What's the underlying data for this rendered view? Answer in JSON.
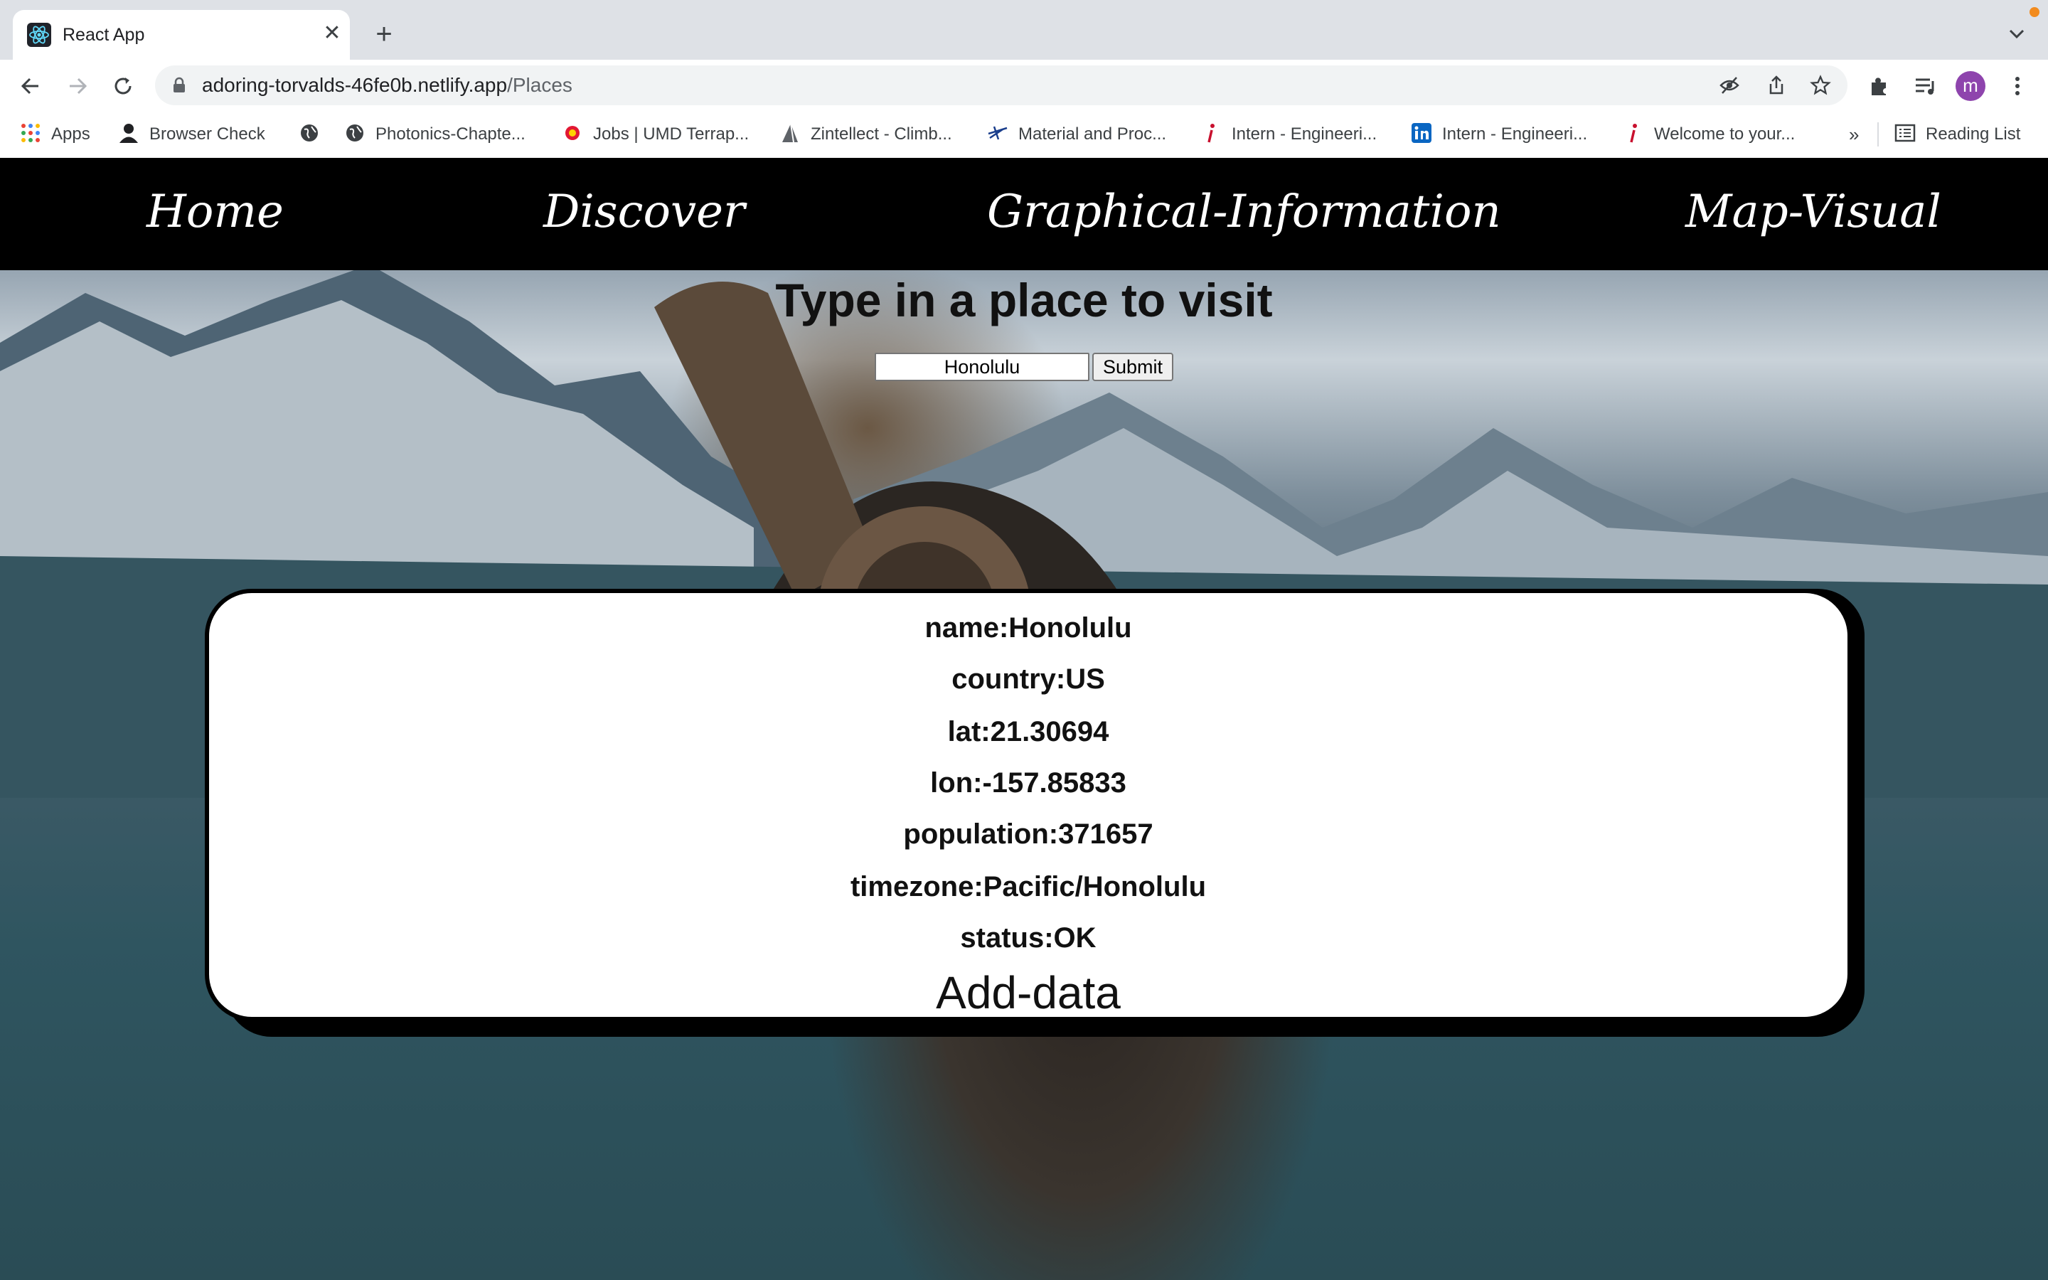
{
  "browser": {
    "tab": {
      "title": "React App",
      "favicon": "react-icon"
    },
    "address": {
      "domain": "adoring-torvalds-46fe0b.netlify.app",
      "path": "/Places"
    },
    "profile_initial": "m",
    "bookmarks": [
      {
        "label": "Apps",
        "icon": "apps-grid-icon"
      },
      {
        "label": "Browser Check",
        "icon": "person-icon"
      },
      {
        "label": "",
        "icon": "globe-icon"
      },
      {
        "label": "Photonics-Chapte...",
        "icon": "globe-icon"
      },
      {
        "label": "Jobs | UMD Terrap...",
        "icon": "umd-icon"
      },
      {
        "label": "Zintellect - Climb...",
        "icon": "zintellect-icon"
      },
      {
        "label": "Material and Proc...",
        "icon": "plane-icon"
      },
      {
        "label": "Intern - Engineeri...",
        "icon": "info-icon"
      },
      {
        "label": "Intern - Engineeri...",
        "icon": "linkedin-icon"
      },
      {
        "label": "Welcome to your...",
        "icon": "info-icon"
      }
    ],
    "more": "»",
    "reading_list": "Reading List"
  },
  "nav": {
    "home": "Home",
    "discover": "Discover",
    "graphical": "Graphical-Information",
    "map": "Map-Visual"
  },
  "search": {
    "heading": "Type in a place to visit",
    "value": "Honolulu",
    "submit": "Submit"
  },
  "place": {
    "name": "name:Honolulu",
    "country": "country:US",
    "lat": "lat:21.30694",
    "lon": "lon:-157.85833",
    "population": "population:371657",
    "timezone": "timezone:Pacific/Honolulu",
    "status": "status:OK"
  },
  "add_data": "Add-data"
}
